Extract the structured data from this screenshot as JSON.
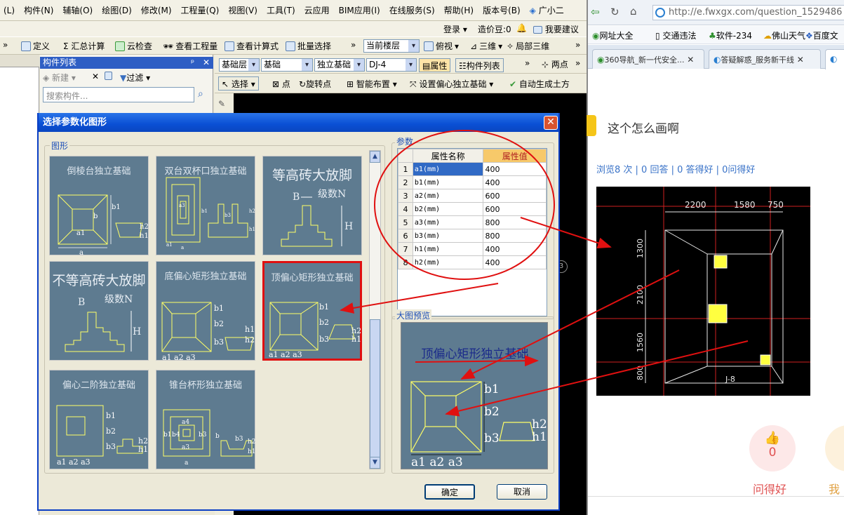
{
  "menu": [
    "(L)",
    "构件(N)",
    "辅轴(O)",
    "绘图(D)",
    "修改(M)",
    "工程量(Q)",
    "视图(V)",
    "工具(T)",
    "云应用",
    "BIM应用(I)",
    "在线服务(S)",
    "帮助(H)",
    "版本号(B)",
    "广小二"
  ],
  "cloudbar": {
    "login": "登录",
    "cost": "造价豆:0",
    "suggest": "我要建议"
  },
  "toolbar1": [
    "定义",
    "Σ 汇总计算",
    "云检查",
    "查看工程量",
    "查看计算式",
    "批量选择",
    "当前楼层",
    "俯视",
    "三维",
    "局部三维"
  ],
  "component_panel": {
    "title": "构件列表",
    "new": "新建",
    "filter": "过滤",
    "search_placeholder": "搜索构件..."
  },
  "toolbar2": {
    "layer": "基础层",
    "category": "基础",
    "type": "独立基础",
    "item": "DJ-4",
    "props": "属性",
    "list": "构件列表",
    "twopoint": "两点"
  },
  "toolbar3": [
    "选择",
    "点",
    "旋转点",
    "智能布置",
    "设置偏心独立基础",
    "自动生成土方"
  ],
  "dialog": {
    "title": "选择参数化图形",
    "shapes_group": "图形",
    "params_group": "参数",
    "preview_group": "大图预览",
    "ok": "确定",
    "cancel": "取消",
    "shapes": [
      {
        "name": "倒棱台独立基础"
      },
      {
        "name": "双台双杯口独立基础"
      },
      {
        "name": "等高砖大放脚"
      },
      {
        "name": "不等高砖大放脚"
      },
      {
        "name": "底偏心矩形独立基础"
      },
      {
        "name": "顶偏心矩形独立基础"
      },
      {
        "name": "偏心二阶独立基础"
      },
      {
        "name": "锥台杯形独立基础"
      }
    ],
    "params_header": {
      "no": "",
      "name": "属性名称",
      "value": "属性值"
    },
    "params": [
      {
        "no": "1",
        "name": "a1(mm)",
        "value": "400"
      },
      {
        "no": "2",
        "name": "b1(mm)",
        "value": "400"
      },
      {
        "no": "3",
        "name": "a2(mm)",
        "value": "600"
      },
      {
        "no": "4",
        "name": "b2(mm)",
        "value": "600"
      },
      {
        "no": "5",
        "name": "a3(mm)",
        "value": "800"
      },
      {
        "no": "6",
        "name": "b3(mm)",
        "value": "800"
      },
      {
        "no": "7",
        "name": "h1(mm)",
        "value": "400"
      },
      {
        "no": "8",
        "name": "h2(mm)",
        "value": "400"
      }
    ],
    "preview_title": "顶偏心矩形独立基础"
  },
  "browser": {
    "url": "http://e.fwxgx.com/question_1529486",
    "favorites": [
      "网址大全",
      "交通违法",
      "软件-234",
      "佛山天气",
      "百度文"
    ],
    "tabs": [
      "360导航_新一代安全...",
      "答疑解惑_服务新干线"
    ],
    "question_title": "这个怎么画啊",
    "stats": "浏览8 次 | 0 回答 | 0 答得好 | 0问得好",
    "like_count": "0",
    "like_label": "问得好",
    "me_label": "我"
  },
  "cad": {
    "dims_top": [
      "2200",
      "1580",
      "750"
    ],
    "dims_left": [
      "1300",
      "2100",
      "1560",
      "800"
    ],
    "label": "J-8"
  },
  "colors": {
    "accent_red": "#e01010",
    "title_blue": "#0a4fd4",
    "tile_bg": "#5e7b90",
    "cad_line": "#ffff40"
  }
}
